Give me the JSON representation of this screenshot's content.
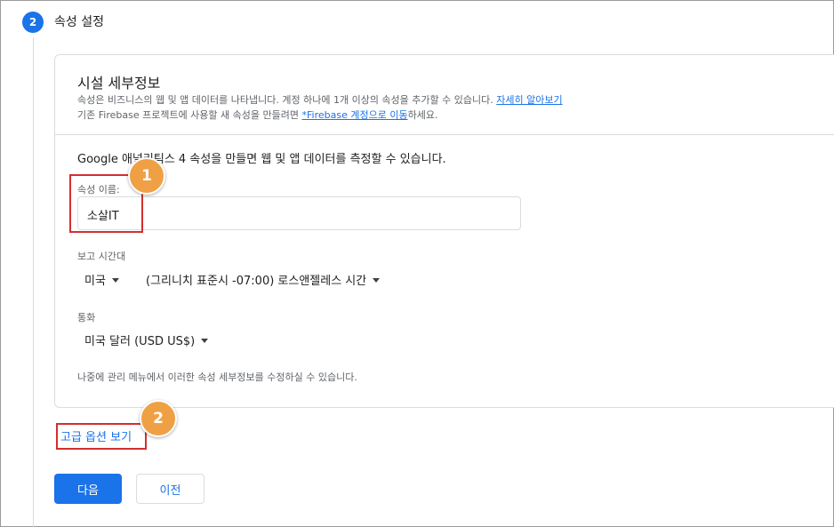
{
  "step": {
    "number": "2",
    "title": "속성 설정"
  },
  "card": {
    "title": "시설 세부정보",
    "desc_line1_prefix": "속성은 비즈니스의 웹 및 앱 데이터를 나타냅니다. 계정 하나에 1개 이상의 속성을 추가할 수 있습니다. ",
    "desc_line1_link": "자세히 알아보기",
    "desc_line2_prefix": "기존 Firebase 프로젝트에 사용할 새 속성을 만들려면 ",
    "desc_line2_link": "*Firebase 계정으로 이동",
    "desc_line2_suffix": "하세요.",
    "intro": "Google 애널리틱스 4 속성을 만들면 웹 및 앱 데이터를 측정할 수 있습니다.",
    "footnote": "나중에 관리 메뉴에서 이러한 속성 세부정보를 수정하실 수 있습니다."
  },
  "fields": {
    "property_name_label": "속성 이름:",
    "property_name_value": "소살IT",
    "timezone_label": "보고 시간대",
    "timezone_country": "미국",
    "timezone_value": "(그리니치 표준시 -07:00) 로스앤젤레스 시간",
    "currency_label": "통화",
    "currency_value": "미국 달러 (USD US$)"
  },
  "annotations": {
    "badge1": "1",
    "badge2": "2"
  },
  "actions": {
    "advanced_options": "고급 옵션 보기",
    "next": "다음",
    "previous": "이전"
  },
  "colors": {
    "accent": "#1a73e8",
    "highlight": "#d32f2f",
    "badge": "#f0a044"
  }
}
